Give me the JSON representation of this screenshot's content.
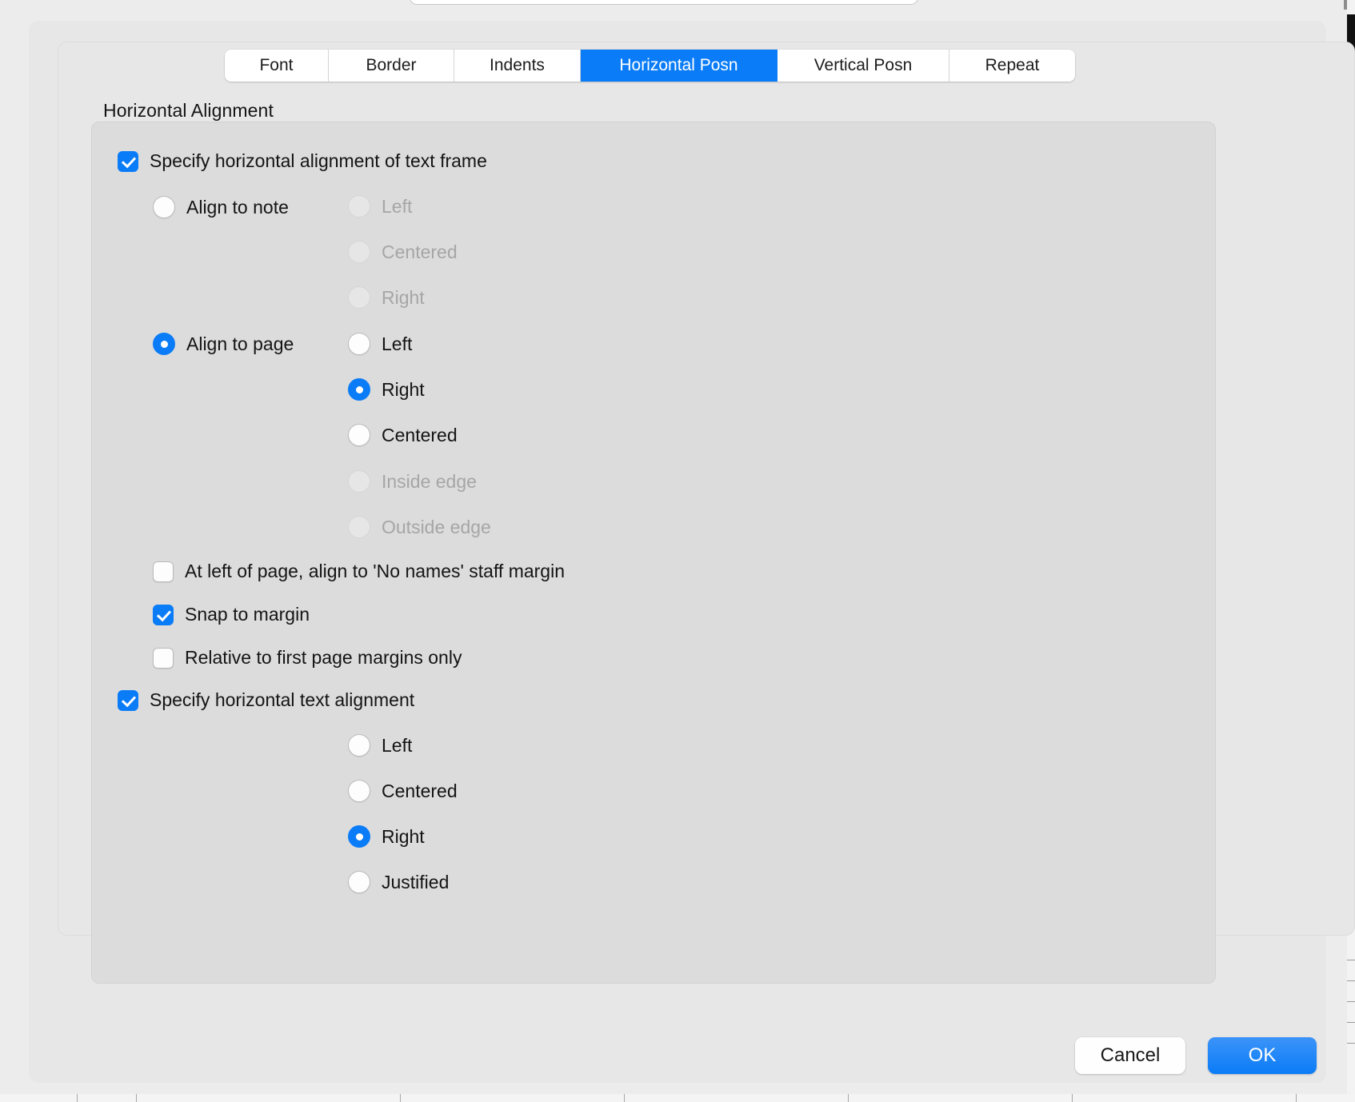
{
  "colors": {
    "accent": "#0a7cf7",
    "dialog_bg": "#e7e7e7",
    "group_bg": "#dcdcdc",
    "window_bg": "#ececec",
    "label": "#141414",
    "label_disabled": "#a6a6a6"
  },
  "tabs": [
    {
      "label": "Font",
      "active": false
    },
    {
      "label": "Border",
      "active": false
    },
    {
      "label": "Indents",
      "active": false
    },
    {
      "label": "Horizontal Posn",
      "active": true
    },
    {
      "label": "Vertical Posn",
      "active": false
    },
    {
      "label": "Repeat",
      "active": false
    }
  ],
  "group": {
    "title": "Horizontal Alignment"
  },
  "frame_alignment": {
    "specify_checkbox": {
      "label": "Specify horizontal alignment of text frame",
      "checked": true
    },
    "modes": [
      {
        "label": "Align to note",
        "selected": false
      },
      {
        "label": "Align to page",
        "selected": true
      }
    ],
    "note_options": [
      {
        "label": "Left",
        "selected": false,
        "disabled": true
      },
      {
        "label": "Centered",
        "selected": false,
        "disabled": true
      },
      {
        "label": "Right",
        "selected": false,
        "disabled": true
      }
    ],
    "page_options": [
      {
        "label": "Left",
        "selected": false,
        "disabled": false
      },
      {
        "label": "Right",
        "selected": true,
        "disabled": false
      },
      {
        "label": "Centered",
        "selected": false,
        "disabled": false
      },
      {
        "label": "Inside edge",
        "selected": false,
        "disabled": true
      },
      {
        "label": "Outside edge",
        "selected": false,
        "disabled": true
      }
    ],
    "extra_checkboxes": [
      {
        "label": "At left of page, align to 'No names' staff margin",
        "checked": false
      },
      {
        "label": "Snap to margin",
        "checked": true
      },
      {
        "label": "Relative to first page margins only",
        "checked": false
      }
    ]
  },
  "text_alignment": {
    "specify_checkbox": {
      "label": "Specify horizontal text alignment",
      "checked": true
    },
    "options": [
      {
        "label": "Left",
        "selected": false
      },
      {
        "label": "Centered",
        "selected": false
      },
      {
        "label": "Right",
        "selected": true
      },
      {
        "label": "Justified",
        "selected": false
      }
    ]
  },
  "footer": {
    "cancel_label": "Cancel",
    "ok_label": "OK"
  }
}
